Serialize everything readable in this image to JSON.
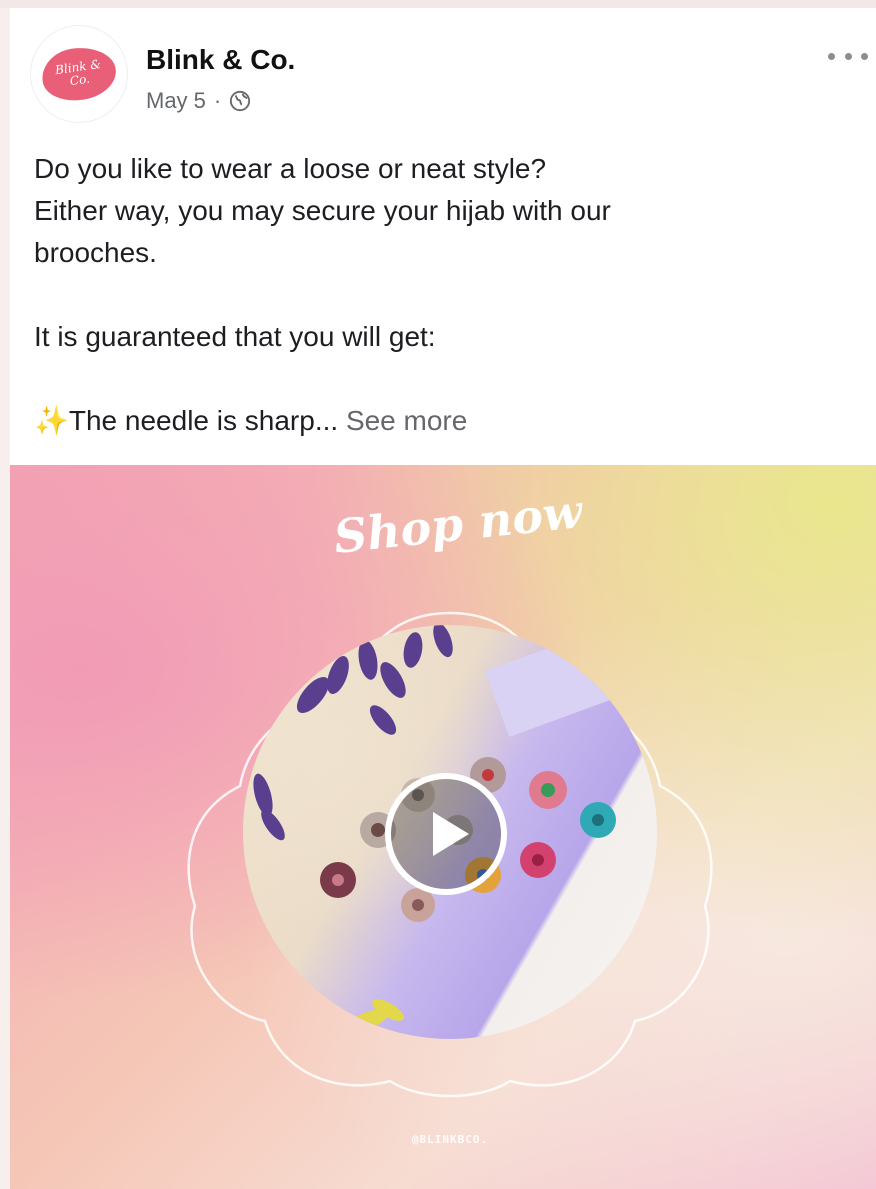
{
  "post": {
    "page_name": "Blink & Co.",
    "date": "May 5",
    "separator": "·",
    "audience_icon": "globe-icon",
    "avatar_text": "Blink & Co.",
    "more_icon": "more-options-icon",
    "caption": {
      "line1": "Do you like to wear a loose or neat style?",
      "line2": "Either way, you may secure your hijab with our",
      "line3": "brooches.",
      "line4": "It is guaranteed that you will get:",
      "sparkle": "✨",
      "line5": "The needle is sharp",
      "ellipsis": "...",
      "see_more": "See more"
    }
  },
  "media": {
    "type": "video",
    "overlay_title": "Shop now",
    "handle": "@BLINKBCO.",
    "play_icon": "play-icon",
    "colors": {
      "pink": "#f29bb6",
      "yellow": "#e9e78d",
      "lavender": "#b7a6ea"
    }
  }
}
